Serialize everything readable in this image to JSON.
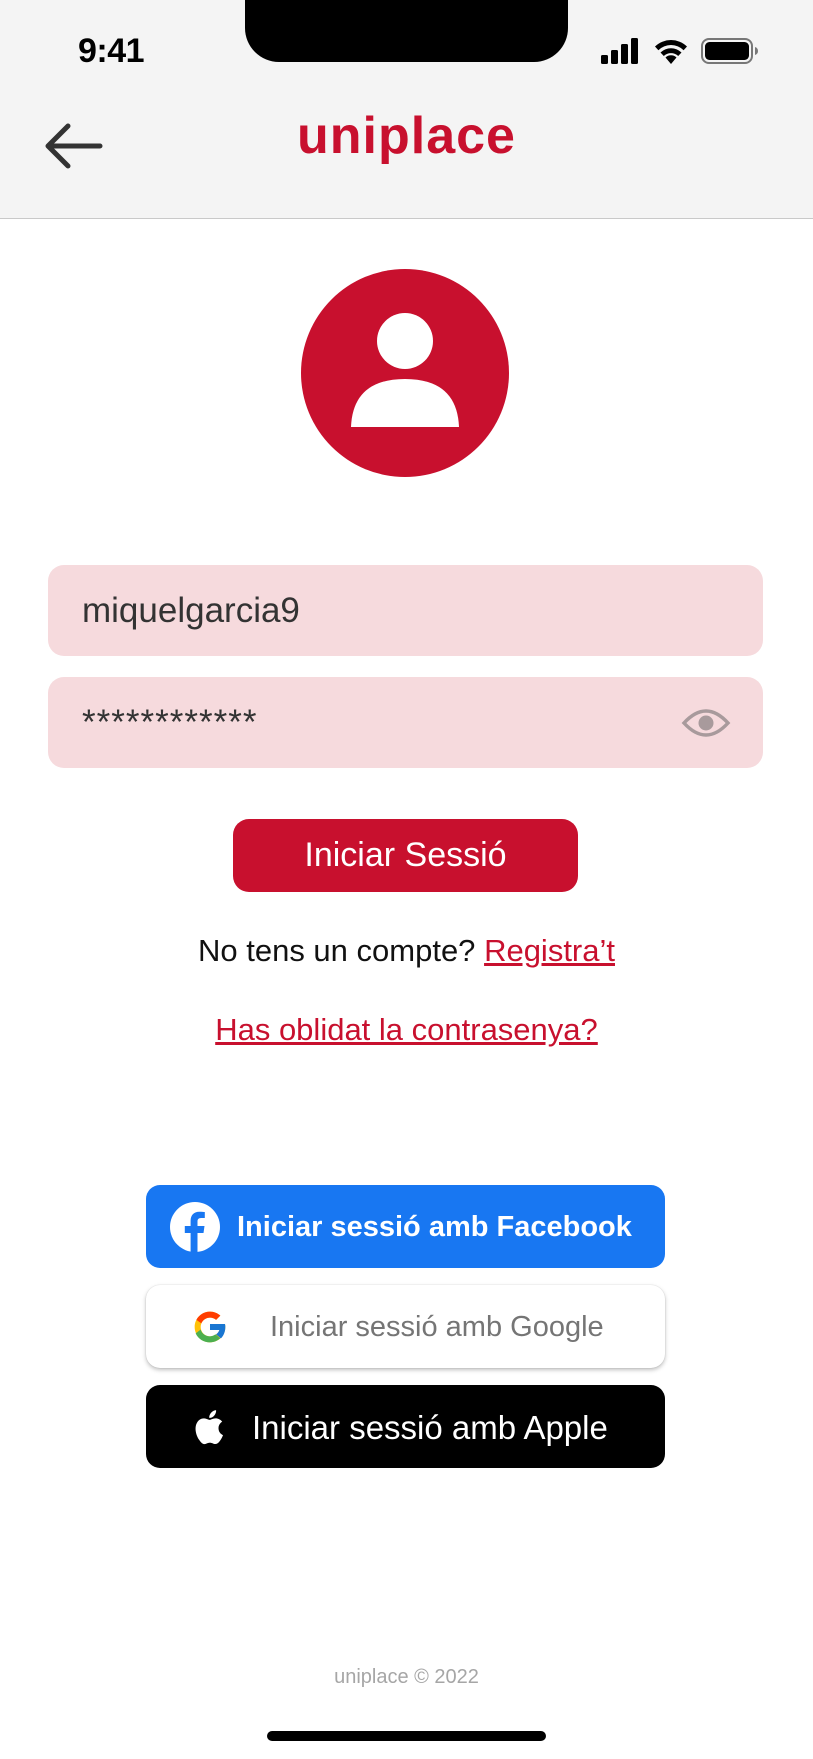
{
  "status_bar": {
    "time": "9:41"
  },
  "header": {
    "title": "uniplace",
    "back_icon": "arrow-left-icon"
  },
  "avatar": {
    "icon": "user-icon",
    "color": "#c8102e"
  },
  "login_form": {
    "username_value": "miquelgarcia9",
    "password_value": "************",
    "password_toggle_icon": "eye-icon",
    "submit_label": "Iniciar Sessió"
  },
  "register": {
    "prompt": "No tens un compte?",
    "link_label": "Registra’t"
  },
  "forgot_password": {
    "link_label": "Has oblidat la contrasenya?"
  },
  "social_login": {
    "facebook_label": "Iniciar sessió amb Facebook",
    "google_label": "Iniciar sessió amb Google",
    "apple_label": "Iniciar sessió amb Apple"
  },
  "footer": {
    "text": "uniplace © 2022"
  },
  "colors": {
    "brand": "#c8102e",
    "field_bg": "#f6dadd",
    "facebook": "#1877f2",
    "apple": "#000000"
  }
}
